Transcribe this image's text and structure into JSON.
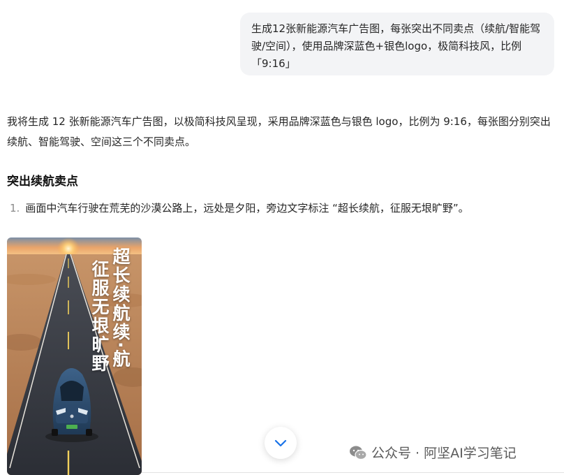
{
  "user_message": {
    "text": "生成12张新能源汽车广告图，每张突出不同卖点（续航/智能驾驶/空间），使用品牌深蓝色+银色logo，极简科技风，比例 「9:16」"
  },
  "assistant": {
    "intro": "我将生成 12 张新能源汽车广告图，以极简科技风呈现，采用品牌深蓝色与银色 logo，比例为 9:16，每张图分别突出续航、智能驾驶、空间这三个不同卖点。",
    "section_heading": "突出续航卖点",
    "list": [
      {
        "num": "1.",
        "text": "画面中汽车行驶在荒芜的沙漠公路上，远处是夕阳，旁边文字标注 “超长续航，征服无垠旷野”。"
      }
    ],
    "image": {
      "column1": "超长续航续·航",
      "column2": "征服无垠旷野"
    }
  },
  "watermark": {
    "text": "公众号 · 阿坚AI学习笔记",
    "icon": "wechat-icon"
  },
  "scroll_button": {
    "icon": "chevron-down-icon"
  },
  "colors": {
    "bubble_bg": "#f3f4f6",
    "accent_blue": "#1a73e8",
    "car_blue": "#2b4f73"
  }
}
